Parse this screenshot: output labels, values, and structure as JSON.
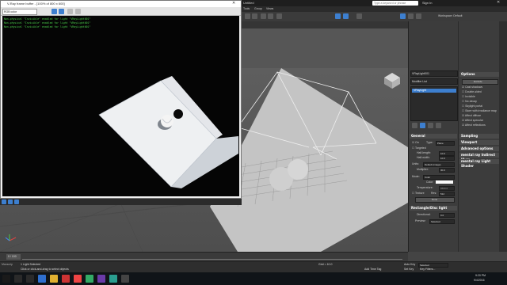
{
  "vfb": {
    "title": "V-Ray frame buffer - [100% of 800 x 600]",
    "channel": "RGB color",
    "log_lines": [
      "Non-physical \"Invisible\" enabled for light \"VRayLight001\"",
      "Non-physical \"Invisible\" enabled for light \"VRayLight001\"",
      "Non-physical \"Invisible\" enabled for light \"VRayLight001\""
    ]
  },
  "max": {
    "title": "Untitled",
    "menu": [
      "Tools",
      "Group",
      "Views",
      "Create",
      "Modifiers",
      "Animation",
      "Graph Editors",
      "Rendering",
      "Civil View",
      "Customize",
      "Scripting",
      "Help"
    ],
    "search_placeholder": "Type a keyword or phrase",
    "sign_in": "Sign In",
    "workspace": "Workspace: Default",
    "viewport_label": "[+] [Perspective] [Standard] [Default Shading]"
  },
  "command_panel": {
    "object_name": "VRayLight001",
    "modifier_list": "Modifier List",
    "stack_item": "VRayLight"
  },
  "rollouts": {
    "options_title": "Options",
    "exclude_button": "Exclude",
    "options": [
      {
        "label": "Cast shadows",
        "checked": true
      },
      {
        "label": "Double-sided",
        "checked": false
      },
      {
        "label": "Invisible",
        "checked": false
      },
      {
        "label": "No decay",
        "checked": false
      },
      {
        "label": "Skylight portal",
        "checked": false
      },
      {
        "label": "Store with irradiance map",
        "checked": false
      },
      {
        "label": "Affect diffuse",
        "checked": true
      },
      {
        "label": "Affect specular",
        "checked": true
      },
      {
        "label": "Affect reflections",
        "checked": true
      }
    ],
    "sampling": "Sampling",
    "viewport": "Viewport",
    "advanced": "Advanced options",
    "mr_indirect": "mental ray Indirect Illum",
    "mr_light_shader": "mental ray Light Shader"
  },
  "general": {
    "title": "General",
    "on_label": "On",
    "type_label": "Type:",
    "type_value": "Plane",
    "targeted": "Targeted",
    "half_length": "Half-length:",
    "half_length_value": "10.0",
    "half_width": "Half-width:",
    "half_width_value": "10.0",
    "units": "Units:",
    "units_value": "Default (image)",
    "multiplier": "Multiplier:",
    "multiplier_value": "30.0",
    "mode": "Mode:",
    "mode_value": "Color",
    "color": "Color:",
    "temperature": "Temperature:",
    "temperature_value": "6500.0",
    "texture": "Texture",
    "res": "Res:",
    "res_value": "512",
    "none_button": "None"
  },
  "rect_disc": {
    "title": "Rectangle/Disc light",
    "directional": "Directional:",
    "directional_value": "0.0",
    "preview": "Preview:",
    "preview_value": "Selected"
  },
  "timeline": {
    "frame": "0 / 100",
    "ticks": [
      "0",
      "10",
      "20",
      "30",
      "40",
      "50",
      "60",
      "70",
      "80",
      "90",
      "100"
    ]
  },
  "status": {
    "script_label": "Maxscrip",
    "selection": "1 Light Selected",
    "prompt": "Click or click-and-drag to select objects",
    "grid": "Grid = 10.0",
    "add_time_tag": "Add Time Tag",
    "auto_key": "Auto Key",
    "selected": "Selected",
    "set_key": "Set Key",
    "key_filters": "Key Filters..."
  },
  "taskbar": {
    "time": "9:20 PM",
    "date": "9/4/2016"
  },
  "colors": {
    "accent": "#3d7fcf",
    "viewport_bg": "#565656",
    "log_green": "#4bd04b",
    "panel": "#3c3c3c"
  }
}
